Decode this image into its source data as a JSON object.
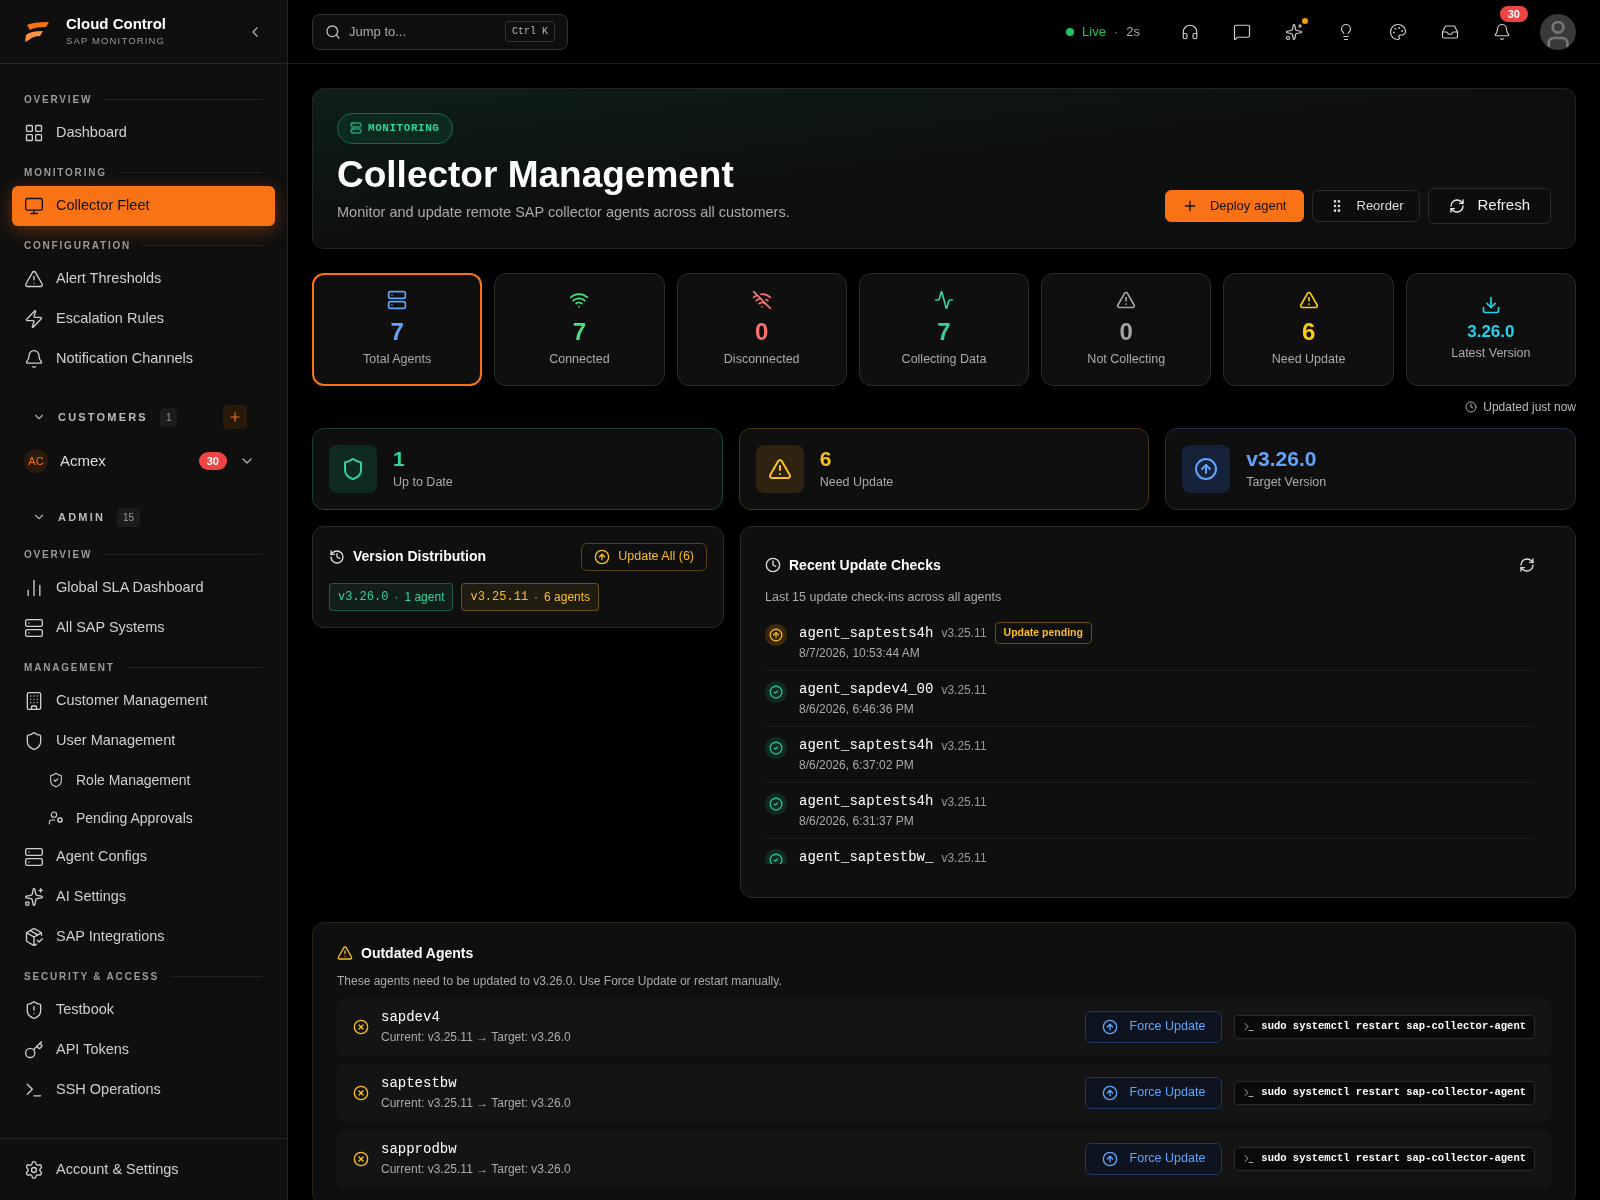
{
  "brand": {
    "title": "Cloud Control",
    "subtitle": "SAP MONITORING"
  },
  "sidebar": {
    "sections": [
      {
        "label": "OVERVIEW",
        "items": [
          {
            "label": "Dashboard",
            "selected": false
          }
        ]
      },
      {
        "label": "MONITORING",
        "items": [
          {
            "label": "Collector Fleet",
            "selected": true
          }
        ]
      },
      {
        "label": "CONFIGURATION",
        "items": [
          {
            "label": "Alert Thresholds",
            "selected": false
          },
          {
            "label": "Escalation Rules",
            "selected": false
          },
          {
            "label": "Notification Channels",
            "selected": false
          }
        ]
      }
    ],
    "customers": {
      "label": "CUSTOMERS",
      "count": "1",
      "expanded": true,
      "items": [
        {
          "initials": "AC",
          "name": "Acmex",
          "badge": "30"
        }
      ]
    },
    "admin": {
      "label": "ADMIN",
      "count": "15",
      "expanded": true,
      "sections": [
        {
          "label": "OVERVIEW",
          "items": [
            {
              "label": "Global SLA Dashboard",
              "selected": false
            },
            {
              "label": "All SAP Systems",
              "selected": false
            }
          ]
        },
        {
          "label": "MANAGEMENT",
          "items": [
            {
              "label": "Customer Management",
              "selected": false
            },
            {
              "label": "User Management",
              "selected": false,
              "children": [
                {
                  "label": "Role Management",
                  "selected": false
                },
                {
                  "label": "Pending Approvals",
                  "selected": false
                }
              ]
            },
            {
              "label": "Agent Configs",
              "selected": false
            },
            {
              "label": "AI Settings",
              "selected": false
            },
            {
              "label": "SAP Integrations",
              "selected": false
            }
          ]
        },
        {
          "label": "SECURITY & ACCESS",
          "items": [
            {
              "label": "Testbook",
              "selected": false
            },
            {
              "label": "API Tokens",
              "selected": false
            },
            {
              "label": "SSH Operations",
              "selected": false
            }
          ]
        }
      ]
    },
    "footer": {
      "label": "Account & Settings"
    }
  },
  "topbar": {
    "search": {
      "placeholder": "Jump to...",
      "shortcut": "Ctrl K"
    },
    "live": {
      "label": "Live",
      "separator": "·",
      "interval": "2s"
    },
    "notifications_badge": "30"
  },
  "header": {
    "badge": "MONITORING",
    "title": "Collector Management",
    "subtitle": "Monitor and update remote SAP collector agents across all customers.",
    "buttons": [
      {
        "kind": "primary",
        "label": "Deploy agent"
      },
      {
        "kind": "reorder",
        "label": "Reorder"
      },
      {
        "kind": "refresh",
        "label": "Refresh"
      }
    ]
  },
  "stats": [
    {
      "kind": "total",
      "value": "7",
      "label": "Total Agents",
      "selected": true
    },
    {
      "kind": "connected",
      "value": "7",
      "label": "Connected",
      "selected": false
    },
    {
      "kind": "disconnected",
      "value": "0",
      "label": "Disconnected",
      "selected": false
    },
    {
      "kind": "collecting",
      "value": "7",
      "label": "Collecting Data",
      "selected": false
    },
    {
      "kind": "notcollecting",
      "value": "0",
      "label": "Not Collecting",
      "selected": false
    },
    {
      "kind": "update",
      "value": "6",
      "label": "Need Update",
      "selected": false
    },
    {
      "kind": "latest",
      "value": "3.26.0",
      "label": "Latest Version",
      "selected": false
    }
  ],
  "updated": "Updated just now",
  "summary": [
    {
      "kind": "ok",
      "value": "1",
      "label": "Up to Date"
    },
    {
      "kind": "warn",
      "value": "6",
      "label": "Need Update"
    },
    {
      "kind": "target",
      "value": "v3.26.0",
      "label": "Target Version"
    }
  ],
  "version_distribution": {
    "title": "Version Distribution",
    "button": "Update All (6)",
    "versions": [
      {
        "version": "v3.26.0",
        "separator": "·",
        "count": "1 agent",
        "color": "#34d399"
      },
      {
        "version": "v3.25.11",
        "separator": "·",
        "count": "6 agents",
        "color": "#fbbf24"
      }
    ]
  },
  "recent_checks": {
    "title": "Recent Update Checks",
    "subtitle": "Last 15 update check-ins across all agents",
    "items": [
      {
        "kind": "pending",
        "agent": "agent_saptests4h",
        "version": "v3.25.11",
        "badge": "Update pending",
        "time": "8/7/2026, 10:53:44 AM"
      },
      {
        "kind": "ok",
        "agent": "agent_sapdev4_00",
        "version": "v3.25.11",
        "time": "8/6/2026, 6:46:36 PM"
      },
      {
        "kind": "ok",
        "agent": "agent_saptests4h",
        "version": "v3.25.11",
        "time": "8/6/2026, 6:37:02 PM"
      },
      {
        "kind": "ok",
        "agent": "agent_saptests4h",
        "version": "v3.25.11",
        "time": "8/6/2026, 6:31:37 PM"
      },
      {
        "kind": "ok",
        "agent": "agent_saptestbw_",
        "version": "v3.25.11"
      }
    ]
  },
  "outdated": {
    "title": "Outdated Agents",
    "subtitle": "These agents need to be updated to v3.26.0. Use Force Update or restart manually.",
    "items": [
      {
        "name": "sapdev4",
        "detail": "Current: v3.25.11 → Target: v3.26.0",
        "button": "Force Update",
        "command": "sudo systemctl restart sap-collector-agent"
      },
      {
        "name": "saptestbw",
        "detail": "Current: v3.25.11 → Target: v3.26.0",
        "button": "Force Update",
        "command": "sudo systemctl restart sap-collector-agent"
      },
      {
        "name": "sapprodbw",
        "detail": "Current: v3.25.11 → Target: v3.26.0",
        "button": "Force Update",
        "command": "sudo systemctl restart sap-collector-agent"
      }
    ]
  }
}
